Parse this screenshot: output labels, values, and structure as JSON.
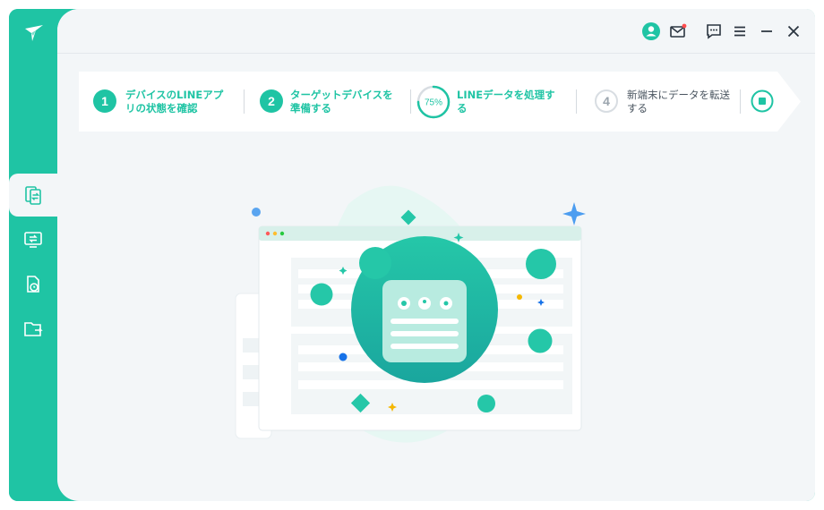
{
  "window": {
    "accent": "#1fc4a4"
  },
  "app": {
    "logo": "app-logo-icon"
  },
  "sidebar": {
    "items": [
      {
        "icon": "phone-transfer-icon",
        "active": true
      },
      {
        "icon": "monitor-transfer-icon",
        "active": false
      },
      {
        "icon": "backup-restore-icon",
        "active": false
      },
      {
        "icon": "folder-export-icon",
        "active": false
      }
    ]
  },
  "titlebar": {
    "buttons": [
      "user-icon",
      "mail-icon",
      "feedback-icon",
      "menu-icon",
      "minimize-icon",
      "close-icon"
    ]
  },
  "steps": [
    {
      "number": "1",
      "label": "デバイスのLINEアプリの状態を確認",
      "status": "done"
    },
    {
      "number": "2",
      "label": "ターゲットデバイスを準備する",
      "status": "done"
    },
    {
      "number": "",
      "label": "LINEデータを処理する",
      "status": "in-progress",
      "progress_text": "75%",
      "progress": 0.75
    },
    {
      "number": "4",
      "label": "新端末にデータを転送する",
      "status": "pending"
    }
  ]
}
